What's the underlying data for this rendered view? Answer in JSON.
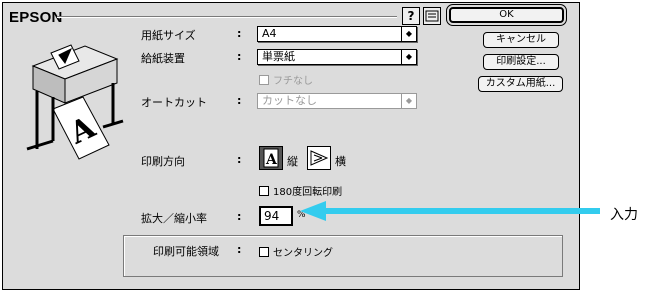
{
  "dialog": {
    "title": "EPSON",
    "help_label": "?",
    "buttons": {
      "ok": "OK",
      "cancel": "キャンセル",
      "print_settings": "印刷設定...",
      "custom_paper": "カスタム用紙..."
    },
    "paper_size": {
      "label": "用紙サイズ",
      "value": "A4"
    },
    "paper_source": {
      "label": "給紙装置",
      "value": "単票紙"
    },
    "borderless": {
      "label": "フチなし",
      "checked": false,
      "enabled": false
    },
    "auto_cut": {
      "label": "オートカット",
      "value": "カットなし",
      "enabled": false
    },
    "orientation": {
      "label": "印刷方向",
      "portrait": "縦",
      "landscape": "横",
      "selected": "portrait"
    },
    "rotate180": {
      "label": "180度回転印刷",
      "checked": false
    },
    "scale": {
      "label": "拡大／縮小率",
      "value": "94",
      "unit": "%"
    },
    "printable_area": {
      "label": "印刷可能領域",
      "centering_label": "センタリング",
      "checked": false
    },
    "colon": ":"
  },
  "annotation": {
    "label": "入力",
    "color": "#33ccee"
  }
}
